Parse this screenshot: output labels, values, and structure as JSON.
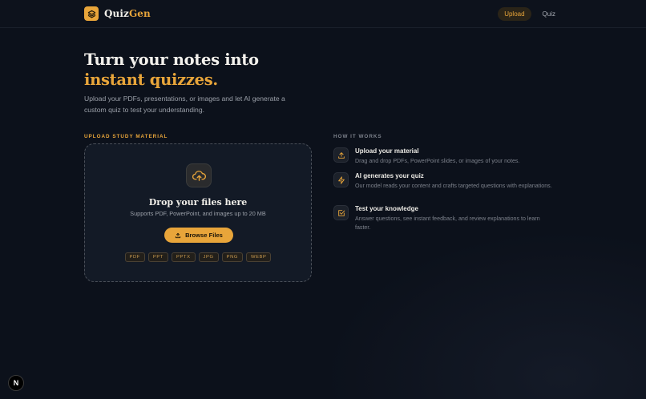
{
  "app": {
    "name_part1": "Quiz",
    "name_part2": "Gen",
    "logo_icon": "layers-icon",
    "accent_color": "#e8a53a"
  },
  "nav": {
    "items": [
      {
        "label": "Upload",
        "active": true
      },
      {
        "label": "Quiz",
        "active": false
      }
    ]
  },
  "hero": {
    "title_line1": "Turn your notes into",
    "title_line2": "instant quizzes.",
    "subtitle": "Upload your PDFs, presentations, or images and let AI generate a custom quiz to test your understanding."
  },
  "upload": {
    "section_label": "UPLOAD STUDY MATERIAL",
    "icon": "cloud-upload-icon",
    "title": "Drop your files here",
    "subtitle": "Supports PDF, PowerPoint, and images up to 20 MB",
    "browse_label": "Browse Files",
    "formats": [
      "PDF",
      "PPT",
      "PPTX",
      "JPG",
      "PNG",
      "WEBP"
    ]
  },
  "how_it_works": {
    "section_label": "HOW IT WORKS",
    "steps": [
      {
        "icon": "upload-icon",
        "title": "Upload your material",
        "description": "Drag and drop PDFs, PowerPoint slides, or images of your notes."
      },
      {
        "icon": "lightning-icon",
        "title": "AI generates your quiz",
        "description": "Our model reads your content and crafts targeted questions with explanations."
      },
      {
        "icon": "checkbox-icon",
        "title": "Test your knowledge",
        "description": "Answer questions, see instant feedback, and review explanations to learn faster."
      }
    ]
  },
  "dev_badge": {
    "label": "N"
  }
}
